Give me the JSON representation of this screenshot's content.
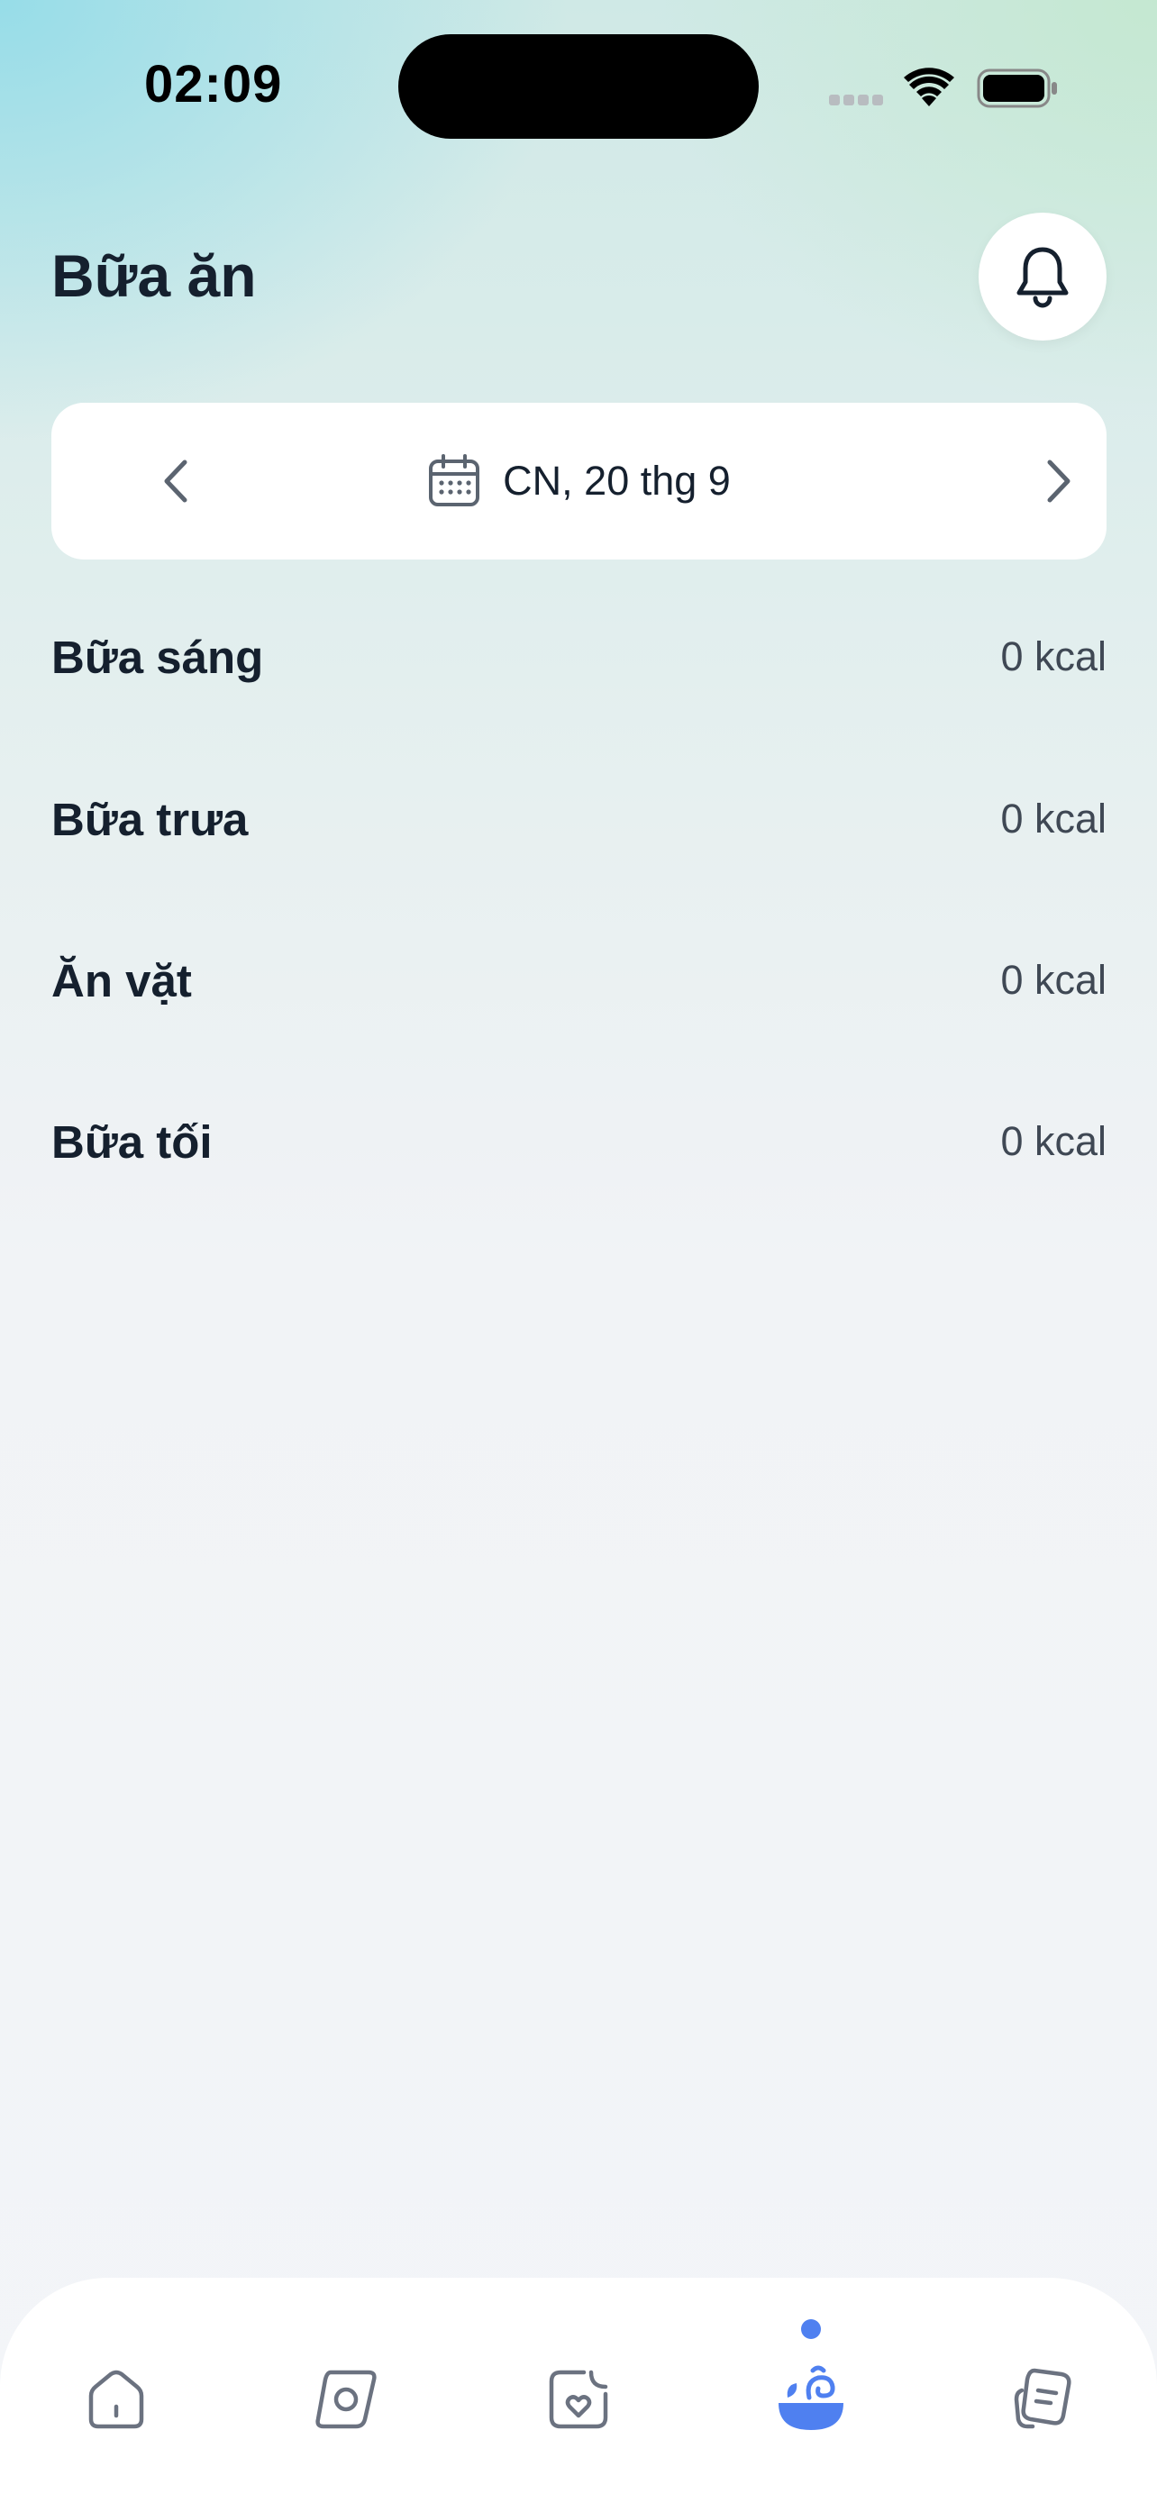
{
  "status_bar": {
    "time": "02:09"
  },
  "header": {
    "title": "Bữa ăn",
    "bell_icon": "bell-icon"
  },
  "date_picker": {
    "label": "CN, 20 thg 9",
    "prev_icon": "chevron-left-icon",
    "next_icon": "chevron-right-icon",
    "calendar_icon": "calendar-icon"
  },
  "meals": [
    {
      "name": "Bữa sáng",
      "kcal": "0 kcal"
    },
    {
      "name": "Bữa trưa",
      "kcal": "0 kcal"
    },
    {
      "name": "Ăn vặt",
      "kcal": "0 kcal"
    },
    {
      "name": "Bữa tối",
      "kcal": "0 kcal"
    }
  ],
  "tab_bar": {
    "tabs": [
      {
        "icon": "home-icon",
        "active": false
      },
      {
        "icon": "explore-icon",
        "active": false
      },
      {
        "icon": "health-journal-icon",
        "active": false
      },
      {
        "icon": "meal-bowl-icon",
        "active": true
      },
      {
        "icon": "notes-icon",
        "active": false
      }
    ]
  },
  "colors": {
    "accent": "#4f80f0",
    "text_primary": "#15202e",
    "text_secondary": "#3f4854",
    "icon_inactive": "#6b7280"
  }
}
